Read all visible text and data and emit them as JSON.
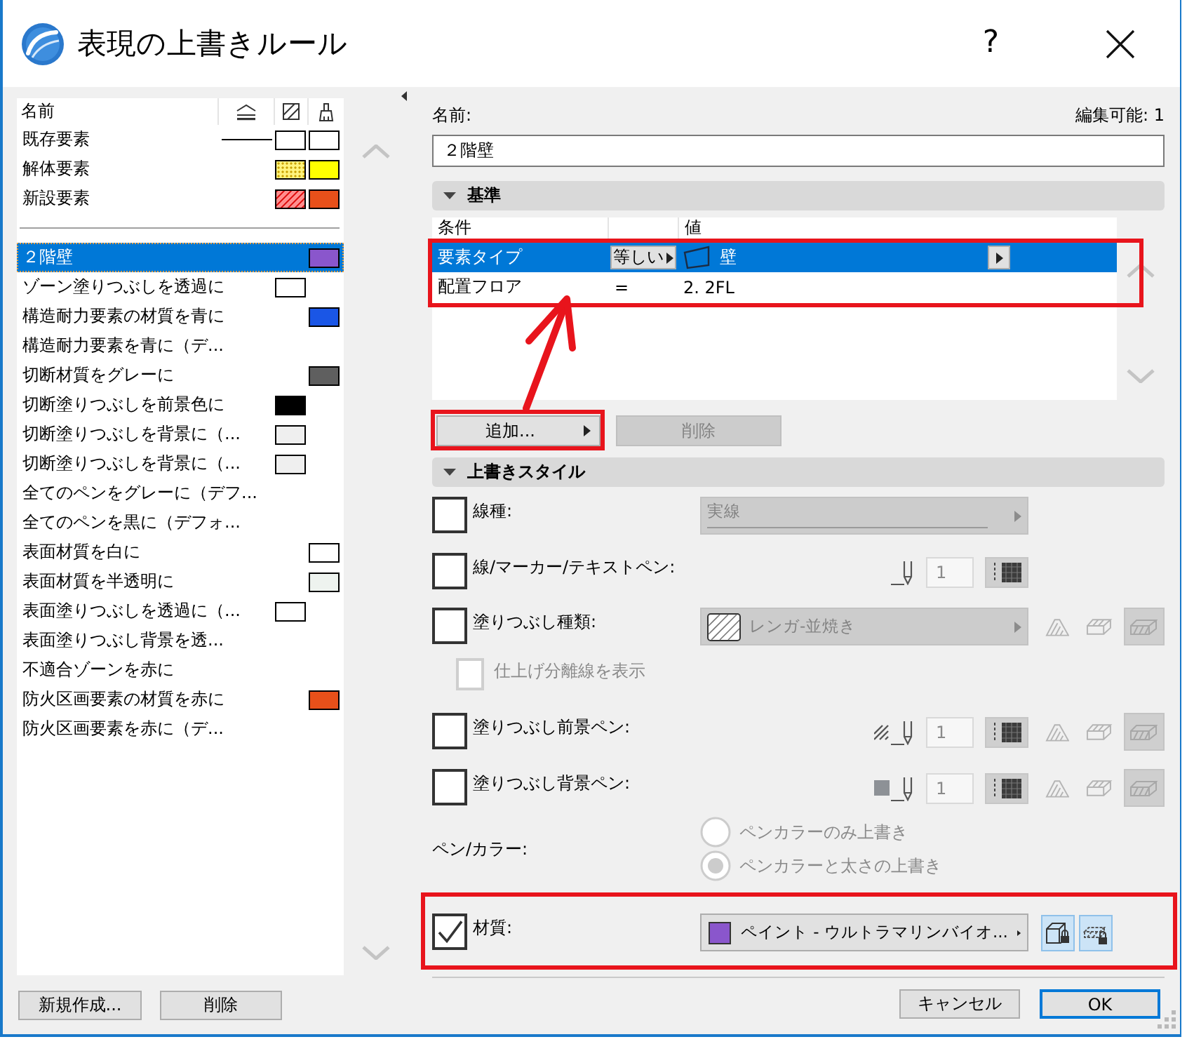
{
  "window": {
    "title": "表現の上書きルール",
    "help": "?"
  },
  "rule_list": {
    "header": "名前",
    "statuses": [
      {
        "name": "既存要素",
        "line": true,
        "fill": {
          "color": "#ffffff",
          "kind": "solid"
        },
        "material": {
          "color": "#ffffff"
        }
      },
      {
        "name": "解体要素",
        "line": false,
        "fill": {
          "color": "#fff47e",
          "kind": "dots"
        },
        "material": {
          "color": "#ffff00"
        }
      },
      {
        "name": "新設要素",
        "line": false,
        "fill": {
          "color": "#ff8e8e",
          "kind": "hatch"
        },
        "material": {
          "color": "#e8501a"
        }
      }
    ],
    "rules": [
      {
        "name": "２階壁",
        "selected": true,
        "material": {
          "color": "#8a56cc"
        }
      },
      {
        "name": "ゾーン塗りつぶしを透過に",
        "selected": false,
        "fill": {
          "color": "#ffffff"
        }
      },
      {
        "name": "構造耐力要素の材質を青に",
        "selected": false,
        "material": {
          "color": "#1a56e6"
        }
      },
      {
        "name": "構造耐力要素を青に（デ...",
        "selected": false
      },
      {
        "name": "切断材質をグレーに",
        "selected": false,
        "material": {
          "color": "#5f5f5f"
        }
      },
      {
        "name": "切断塗りつぶしを前景色に",
        "selected": false,
        "fill": {
          "color": "#000000"
        }
      },
      {
        "name": "切断塗りつぶしを背景に（...",
        "selected": false,
        "fill": {
          "color": "#efefef"
        }
      },
      {
        "name": "切断塗りつぶしを背景に（...",
        "selected": false,
        "fill": {
          "color": "#efefef"
        }
      },
      {
        "name": "全てのペンをグレーに（デフ...",
        "selected": false
      },
      {
        "name": "全てのペンを黒に（デフォ...",
        "selected": false
      },
      {
        "name": "表面材質を白に",
        "selected": false,
        "material": {
          "color": "#ffffff"
        }
      },
      {
        "name": "表面材質を半透明に",
        "selected": false,
        "material": {
          "color": "#eef3ef"
        }
      },
      {
        "name": "表面塗りつぶしを透過に（...",
        "selected": false,
        "fill": {
          "color": "#ffffff"
        }
      },
      {
        "name": "表面塗りつぶし背景を透...",
        "selected": false
      },
      {
        "name": "不適合ゾーンを赤に",
        "selected": false
      },
      {
        "name": "防火区画要素の材質を赤に",
        "selected": false,
        "material": {
          "color": "#e8501a"
        }
      },
      {
        "name": "防火区画要素を赤に（デ...",
        "selected": false
      }
    ],
    "buttons": [
      "新規作成...",
      "削除"
    ]
  },
  "editor": {
    "name_label": "名前:",
    "edit_count": "編集可能: 1",
    "name_value": "２階壁",
    "criteria": {
      "title": "基準",
      "expanded": true,
      "highlighted": true,
      "columns": [
        "条件",
        "値"
      ],
      "rows": [
        {
          "kind": "type",
          "condition": "要素タイプ",
          "operator": "等しい",
          "value": "壁",
          "selected": true
        },
        {
          "kind": "floor",
          "condition": "配置フロア",
          "operator": "=",
          "value": "2. 2FL",
          "selected": false
        }
      ],
      "buttons": [
        {
          "label": "追加...",
          "disabled": false,
          "menu": true,
          "highlighted": true
        },
        {
          "label": "削除",
          "disabled": true,
          "menu": false,
          "highlighted": false
        }
      ]
    },
    "override_style": {
      "title": "上書きスタイル",
      "expanded": true,
      "rows": [
        {
          "kind": "linetype",
          "label": "線種:",
          "checked": false,
          "disabled": true,
          "value": "実線",
          "highlighted": false
        },
        {
          "kind": "pen",
          "label": "線/マーカー/テキストペン:",
          "checked": false,
          "disabled": true,
          "pen": "1",
          "surface_buttons": false,
          "highlighted": false
        },
        {
          "kind": "filltype",
          "label": "塗りつぶし種類:",
          "checked": false,
          "disabled": true,
          "value": "レンガ-並焼き",
          "surface_buttons": true,
          "highlighted": false
        },
        {
          "kind": "option",
          "label": "仕上げ分離線を表示",
          "checked": false,
          "disabled": true,
          "highlighted": false
        },
        {
          "kind": "hatchpen",
          "label": "塗りつぶし前景ペン:",
          "checked": false,
          "disabled": true,
          "pen": "1",
          "surface_buttons": true,
          "highlighted": false
        },
        {
          "kind": "solidpen",
          "label": "塗りつぶし背景ペン:",
          "checked": false,
          "disabled": true,
          "pen": "1",
          "surface_buttons": true,
          "highlighted": false
        },
        {
          "kind": "radio",
          "label": "ペン/カラー:",
          "disabled": true,
          "highlighted": false,
          "options": [
            {
              "label": "ペンカラーのみ上書き",
              "selected": false
            },
            {
              "label": "ペンカラーと太さの上書き",
              "selected": true
            }
          ]
        },
        {
          "kind": "material",
          "label": "材質:",
          "checked": true,
          "disabled": false,
          "value": "ペイント - ウルトラマリンバイオ...",
          "color": "#8a56cc",
          "highlighted": true,
          "toggles": [
            {
              "selected": true
            },
            {
              "selected": true
            }
          ]
        }
      ]
    }
  },
  "dialog_buttons": [
    {
      "label": "キャンセル",
      "default": false
    },
    {
      "label": "OK",
      "default": true
    }
  ]
}
